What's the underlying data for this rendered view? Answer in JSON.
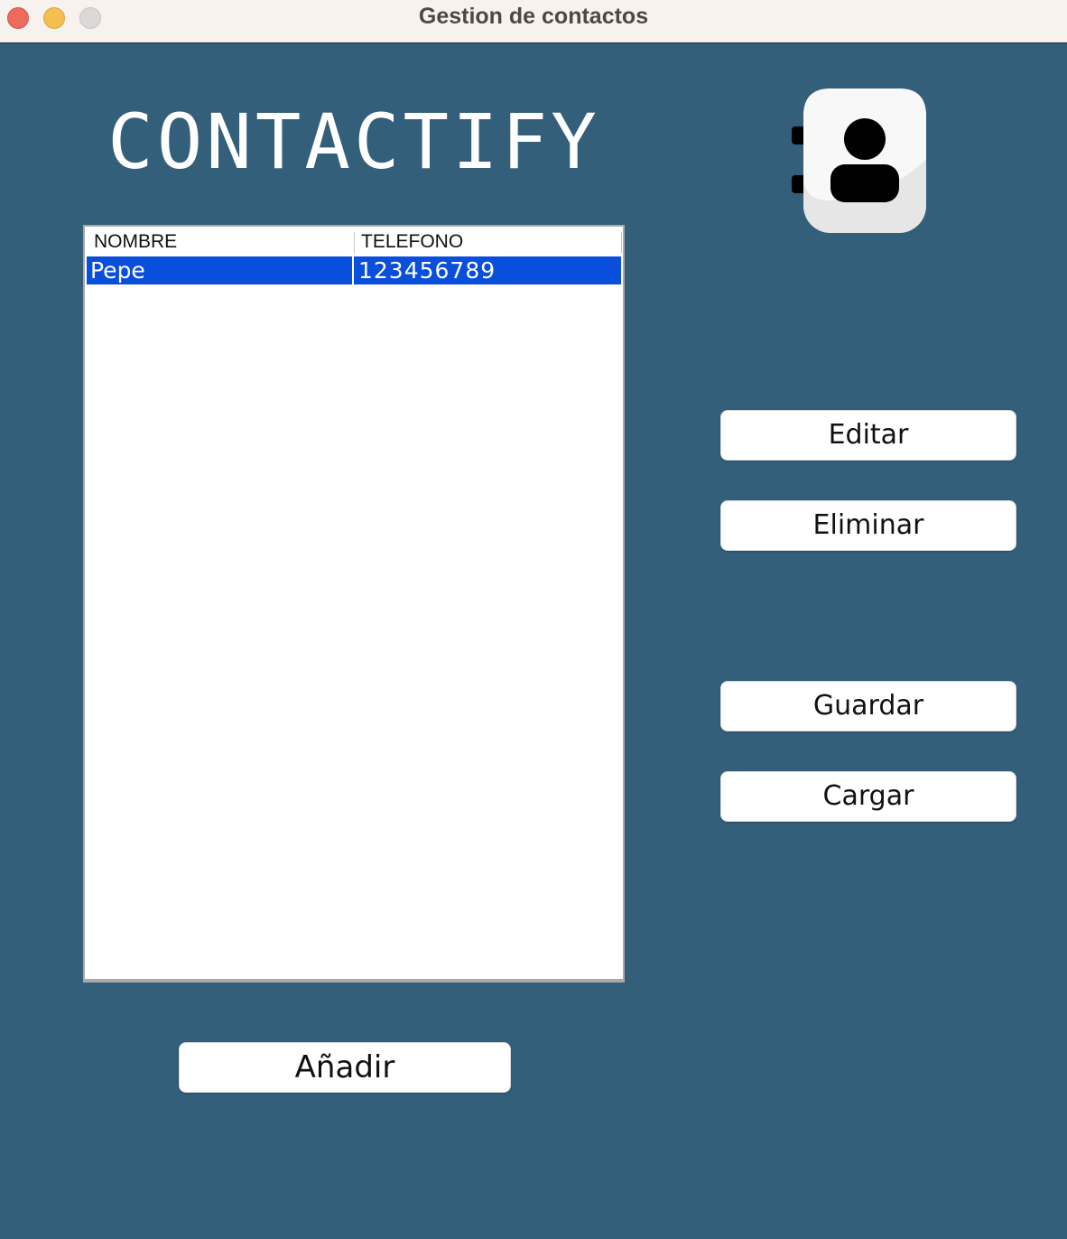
{
  "window": {
    "title": "Gestion de contactos"
  },
  "app": {
    "title": "CONTACTIFY",
    "logo_icon": "contact-book-icon"
  },
  "table": {
    "columns": [
      "NOMBRE",
      "TELEFONO"
    ],
    "rows": [
      {
        "nombre": "Pepe",
        "telefono": "123456789",
        "selected": true
      }
    ],
    "selection_color": "#0a4edc"
  },
  "buttons": {
    "edit": "Editar",
    "delete": "Eliminar",
    "save": "Guardar",
    "load": "Cargar",
    "add": "Añadir"
  },
  "colors": {
    "background": "#345f7a",
    "titlebar": "#f7f2ee"
  }
}
